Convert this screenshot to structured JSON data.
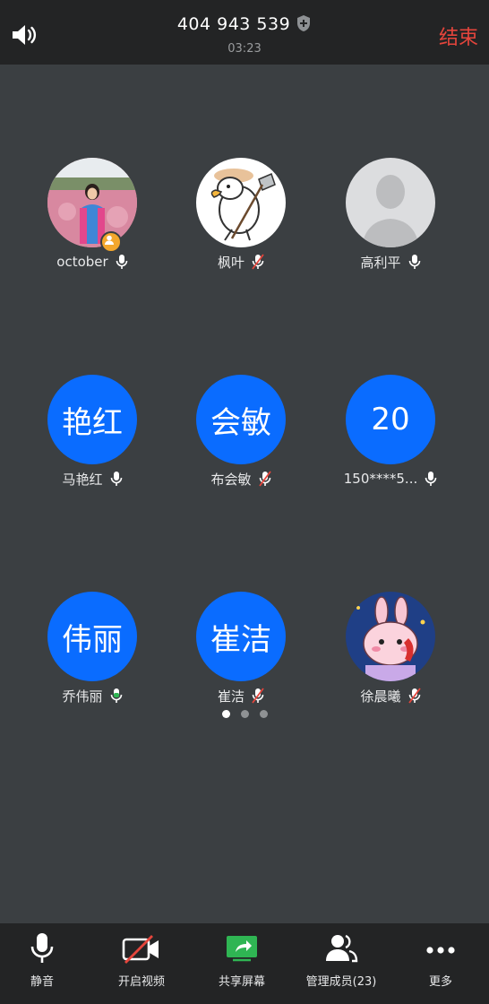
{
  "header": {
    "meeting_id": "404 943 539",
    "timer": "03:23",
    "end_label": "结束",
    "end_color": "#e5453c"
  },
  "participants": [
    {
      "name": "october",
      "avatar": "photo",
      "mic": "on",
      "host": true
    },
    {
      "name": "枫叶",
      "avatar": "duck-cartoon",
      "mic": "muted"
    },
    {
      "name": "高利平",
      "avatar": "default-silhouette",
      "mic": "on"
    },
    {
      "name": "马艳红",
      "avatar_text": "艳红",
      "mic": "on"
    },
    {
      "name": "布会敏",
      "avatar_text": "会敏",
      "mic": "muted"
    },
    {
      "name": "150****5...",
      "avatar_text": "20",
      "mic": "on"
    },
    {
      "name": "乔伟丽",
      "avatar_text": "伟丽",
      "mic": "speaking"
    },
    {
      "name": "崔洁",
      "avatar_text": "崔洁",
      "mic": "muted"
    },
    {
      "name": "徐晨曦",
      "avatar": "pink-bunny",
      "mic": "muted"
    }
  ],
  "pagination": {
    "pages": 3,
    "current": 1
  },
  "toolbar": {
    "mute_label": "静音",
    "video_label": "开启视频",
    "share_label": "共享屏幕",
    "members_label": "管理成员(23)",
    "more_label": "更多"
  },
  "colors": {
    "accent_blue": "#0a6cff",
    "share_green": "#2fb553",
    "muted_red": "#e5453c",
    "background": "#3b3f42",
    "bar": "#232425"
  }
}
